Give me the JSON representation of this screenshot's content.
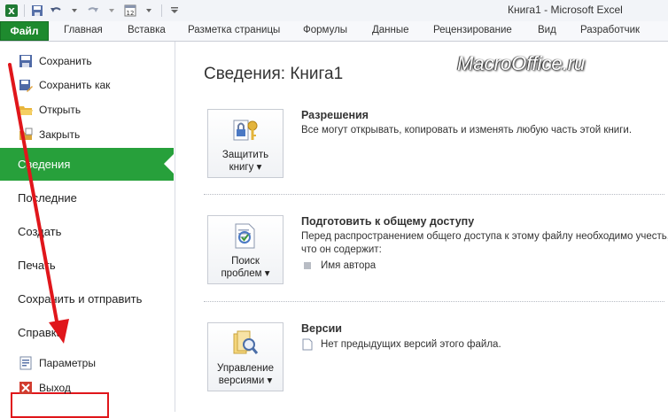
{
  "window": {
    "title": "Книга1  -  Microsoft Excel"
  },
  "tabs": {
    "file": "Файл",
    "items": [
      "Главная",
      "Вставка",
      "Разметка страницы",
      "Формулы",
      "Данные",
      "Рецензирование",
      "Вид",
      "Разработчик"
    ]
  },
  "nav": {
    "commands_top": [
      {
        "label": "Сохранить",
        "icon": "save-icon"
      },
      {
        "label": "Сохранить как",
        "icon": "save-as-icon"
      },
      {
        "label": "Открыть",
        "icon": "open-folder-icon"
      },
      {
        "label": "Закрыть",
        "icon": "close-file-icon"
      }
    ],
    "tabs": [
      "Сведения",
      "Последние",
      "Создать",
      "Печать",
      "Сохранить и отправить",
      "Справка"
    ],
    "commands_bottom": [
      {
        "label": "Параметры",
        "icon": "options-icon"
      },
      {
        "label": "Выход",
        "icon": "exit-icon"
      }
    ],
    "selected": "Сведения",
    "accent": "#27a03b"
  },
  "content": {
    "title": "Сведения: Книга1",
    "watermark": "MacroOffice.ru",
    "sections": [
      {
        "button_line1": "Защитить",
        "button_line2": "книгу",
        "heading": "Разрешения",
        "description": "Все могут открывать, копировать и изменять любую часть этой книги.",
        "icon": "lock-key-icon"
      },
      {
        "button_line1": "Поиск",
        "button_line2": "проблем",
        "heading": "Подготовить к общему доступу",
        "description": "Перед распространением общего доступа к этому файлу необходимо учесть, что он содержит:",
        "bullet": "Имя автора",
        "icon": "inspect-document-icon"
      },
      {
        "button_line1": "Управление",
        "button_line2": "версиями",
        "heading": "Версии",
        "bullet": "Нет предыдущих версий этого файла.",
        "icon": "manage-versions-icon"
      }
    ]
  },
  "annotation": {
    "color": "#e0161b"
  }
}
